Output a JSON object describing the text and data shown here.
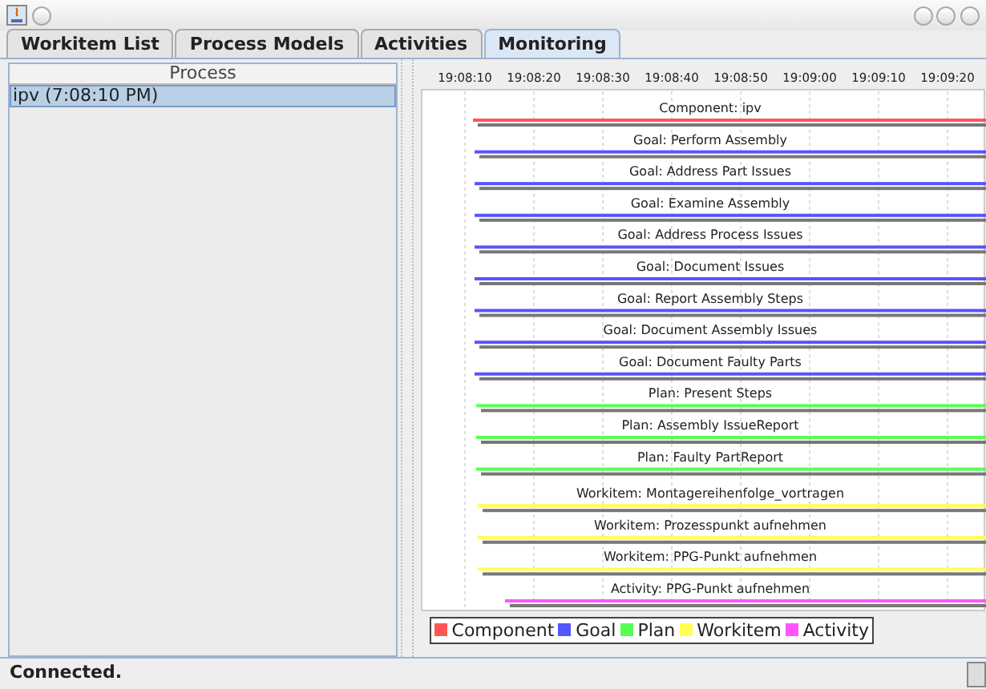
{
  "tabs": [
    {
      "label": "Workitem List",
      "selected": false
    },
    {
      "label": "Process Models",
      "selected": false
    },
    {
      "label": "Activities",
      "selected": false
    },
    {
      "label": "Monitoring",
      "selected": true
    }
  ],
  "process_table": {
    "columns": [
      "Process"
    ],
    "rows": [
      {
        "label": "ipv (7:08:10 PM)",
        "selected": true
      }
    ]
  },
  "timeline": {
    "ticks": [
      "19:08:10",
      "19:08:20",
      "19:08:30",
      "19:08:40",
      "19:08:50",
      "19:09:00",
      "19:09:10",
      "19:09:20"
    ],
    "rows": [
      {
        "label": "Component: ipv",
        "kind": "component"
      },
      {
        "label": "Goal: Perform Assembly",
        "kind": "goal"
      },
      {
        "label": "Goal: Address Part Issues",
        "kind": "goal"
      },
      {
        "label": "Goal: Examine Assembly",
        "kind": "goal"
      },
      {
        "label": "Goal: Address Process Issues",
        "kind": "goal"
      },
      {
        "label": "Goal: Document Issues",
        "kind": "goal"
      },
      {
        "label": "Goal: Report Assembly Steps",
        "kind": "goal"
      },
      {
        "label": "Goal: Document Assembly Issues",
        "kind": "goal"
      },
      {
        "label": "Goal: Document Faulty Parts",
        "kind": "goal"
      },
      {
        "label": "Plan: Present Steps",
        "kind": "plan"
      },
      {
        "label": "Plan: Assembly IssueReport",
        "kind": "plan"
      },
      {
        "label": "Plan: Faulty PartReport",
        "kind": "plan"
      },
      {
        "label": "Workitem: Montagereihenfolge_vortragen",
        "kind": "workitem"
      },
      {
        "label": "Workitem: Prozesspunkt aufnehmen",
        "kind": "workitem"
      },
      {
        "label": "Workitem: PPG-Punkt aufnehmen",
        "kind": "workitem"
      },
      {
        "label": "Activity: PPG-Punkt aufnehmen",
        "kind": "activity"
      }
    ],
    "legend": [
      {
        "label": "Component",
        "kind": "component",
        "color": "#ff5555"
      },
      {
        "label": "Goal",
        "kind": "goal",
        "color": "#5555ff"
      },
      {
        "label": "Plan",
        "kind": "plan",
        "color": "#55ff55"
      },
      {
        "label": "Workitem",
        "kind": "workitem",
        "color": "#ffff55"
      },
      {
        "label": "Activity",
        "kind": "activity",
        "color": "#ff55ff"
      }
    ]
  },
  "status_bar": {
    "text": "Connected."
  }
}
